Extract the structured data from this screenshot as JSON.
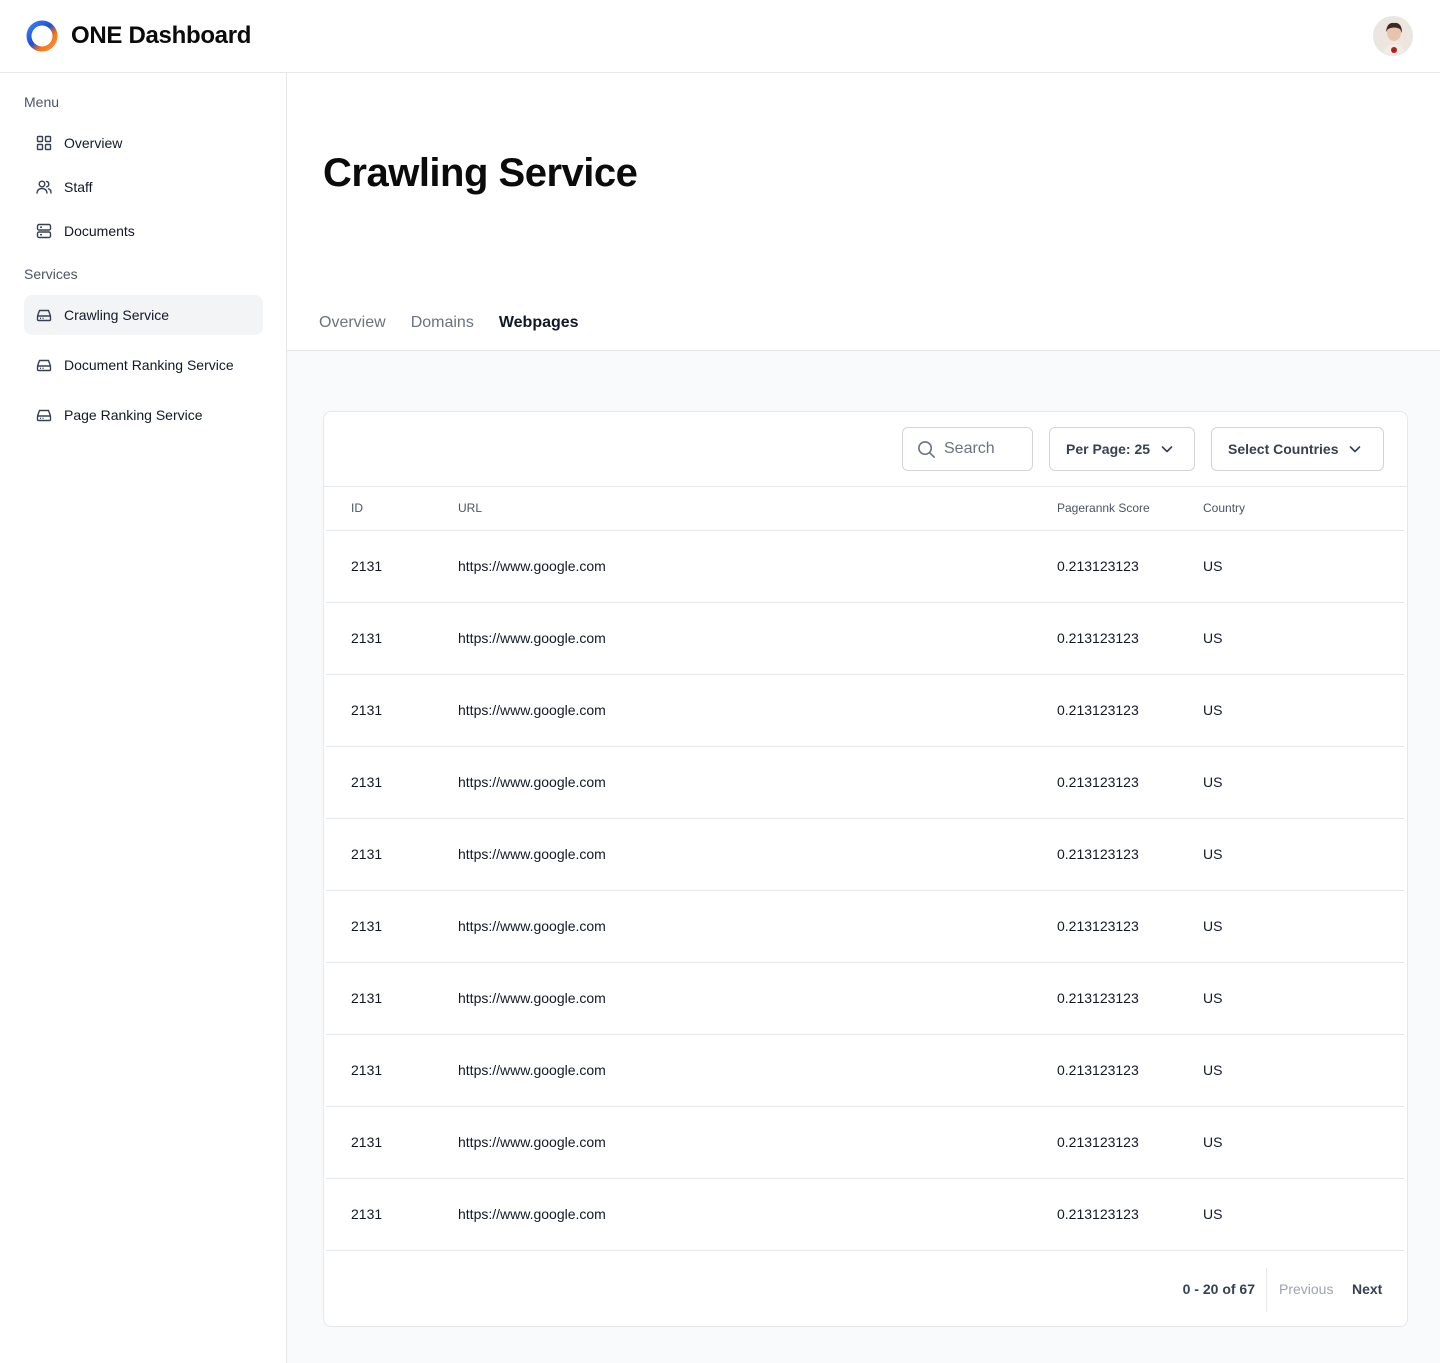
{
  "app": {
    "title": "ONE Dashboard"
  },
  "sidebar": {
    "menu_label": "Menu",
    "menu_items": [
      {
        "label": "Overview",
        "icon": "grid-icon"
      },
      {
        "label": "Staff",
        "icon": "users-icon"
      },
      {
        "label": "Documents",
        "icon": "server-icon"
      }
    ],
    "services_label": "Services",
    "service_items": [
      {
        "label": "Crawling Service",
        "icon": "drive-icon",
        "active": true
      },
      {
        "label": "Document Ranking Service",
        "icon": "drive-icon",
        "active": false
      },
      {
        "label": "Page Ranking Service",
        "icon": "drive-icon",
        "active": false
      }
    ]
  },
  "page": {
    "title": "Crawling Service",
    "tabs": [
      {
        "label": "Overview",
        "active": false
      },
      {
        "label": "Domains",
        "active": false
      },
      {
        "label": "Webpages",
        "active": true
      }
    ]
  },
  "toolbar": {
    "search_placeholder": "Search",
    "per_page_label": "Per Page: 25",
    "countries_label": "Select Countries"
  },
  "table": {
    "columns": [
      "ID",
      "URL",
      "Pagerannk Score",
      "Country"
    ],
    "rows": [
      {
        "id": "2131",
        "url": "https://www.google.com",
        "score": "0.213123123",
        "country": "US"
      },
      {
        "id": "2131",
        "url": "https://www.google.com",
        "score": "0.213123123",
        "country": "US"
      },
      {
        "id": "2131",
        "url": "https://www.google.com",
        "score": "0.213123123",
        "country": "US"
      },
      {
        "id": "2131",
        "url": "https://www.google.com",
        "score": "0.213123123",
        "country": "US"
      },
      {
        "id": "2131",
        "url": "https://www.google.com",
        "score": "0.213123123",
        "country": "US"
      },
      {
        "id": "2131",
        "url": "https://www.google.com",
        "score": "0.213123123",
        "country": "US"
      },
      {
        "id": "2131",
        "url": "https://www.google.com",
        "score": "0.213123123",
        "country": "US"
      },
      {
        "id": "2131",
        "url": "https://www.google.com",
        "score": "0.213123123",
        "country": "US"
      },
      {
        "id": "2131",
        "url": "https://www.google.com",
        "score": "0.213123123",
        "country": "US"
      },
      {
        "id": "2131",
        "url": "https://www.google.com",
        "score": "0.213123123",
        "country": "US"
      }
    ]
  },
  "pagination": {
    "range": "0 - 20 of 67",
    "previous": "Previous",
    "next": "Next"
  },
  "colors": {
    "border": "#e5e7eb",
    "active_bg": "#f3f4f6",
    "muted": "#6b7280",
    "logo_blue": "#2563eb",
    "logo_orange": "#f97316"
  }
}
